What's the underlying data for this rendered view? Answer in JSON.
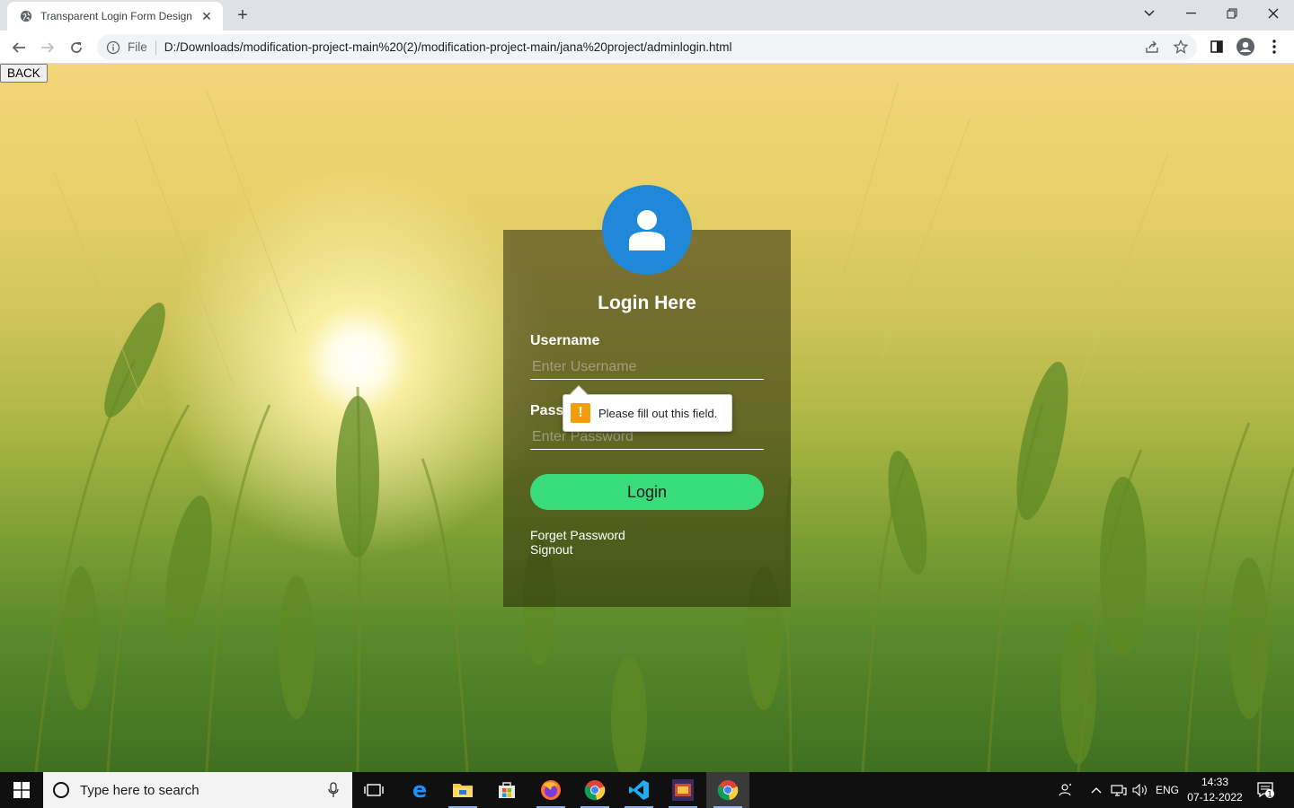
{
  "browser": {
    "tab_title": "Transparent Login Form Design",
    "address_scheme": "File",
    "address_url": "D:/Downloads/modification-project-main%20(2)/modification-project-main/jana%20project/adminlogin.html"
  },
  "page": {
    "back_label": "BACK",
    "login": {
      "title": "Login Here",
      "username_label": "Username",
      "username_placeholder": "Enter Username",
      "password_label": "Password",
      "password_placeholder": "Enter Password",
      "submit_label": "Login",
      "forgot_link": "Forget Password",
      "signout_link": "Signout"
    },
    "validation_tooltip": "Please fill out this field."
  },
  "taskbar": {
    "search_placeholder": "Type here to search",
    "language": "ENG",
    "time": "14:33",
    "date": "07-12-2022",
    "notification_count": "1"
  },
  "colors": {
    "avatar": "#1f88d8",
    "login_button": "#39dc7a",
    "warning": "#f49d0a"
  }
}
